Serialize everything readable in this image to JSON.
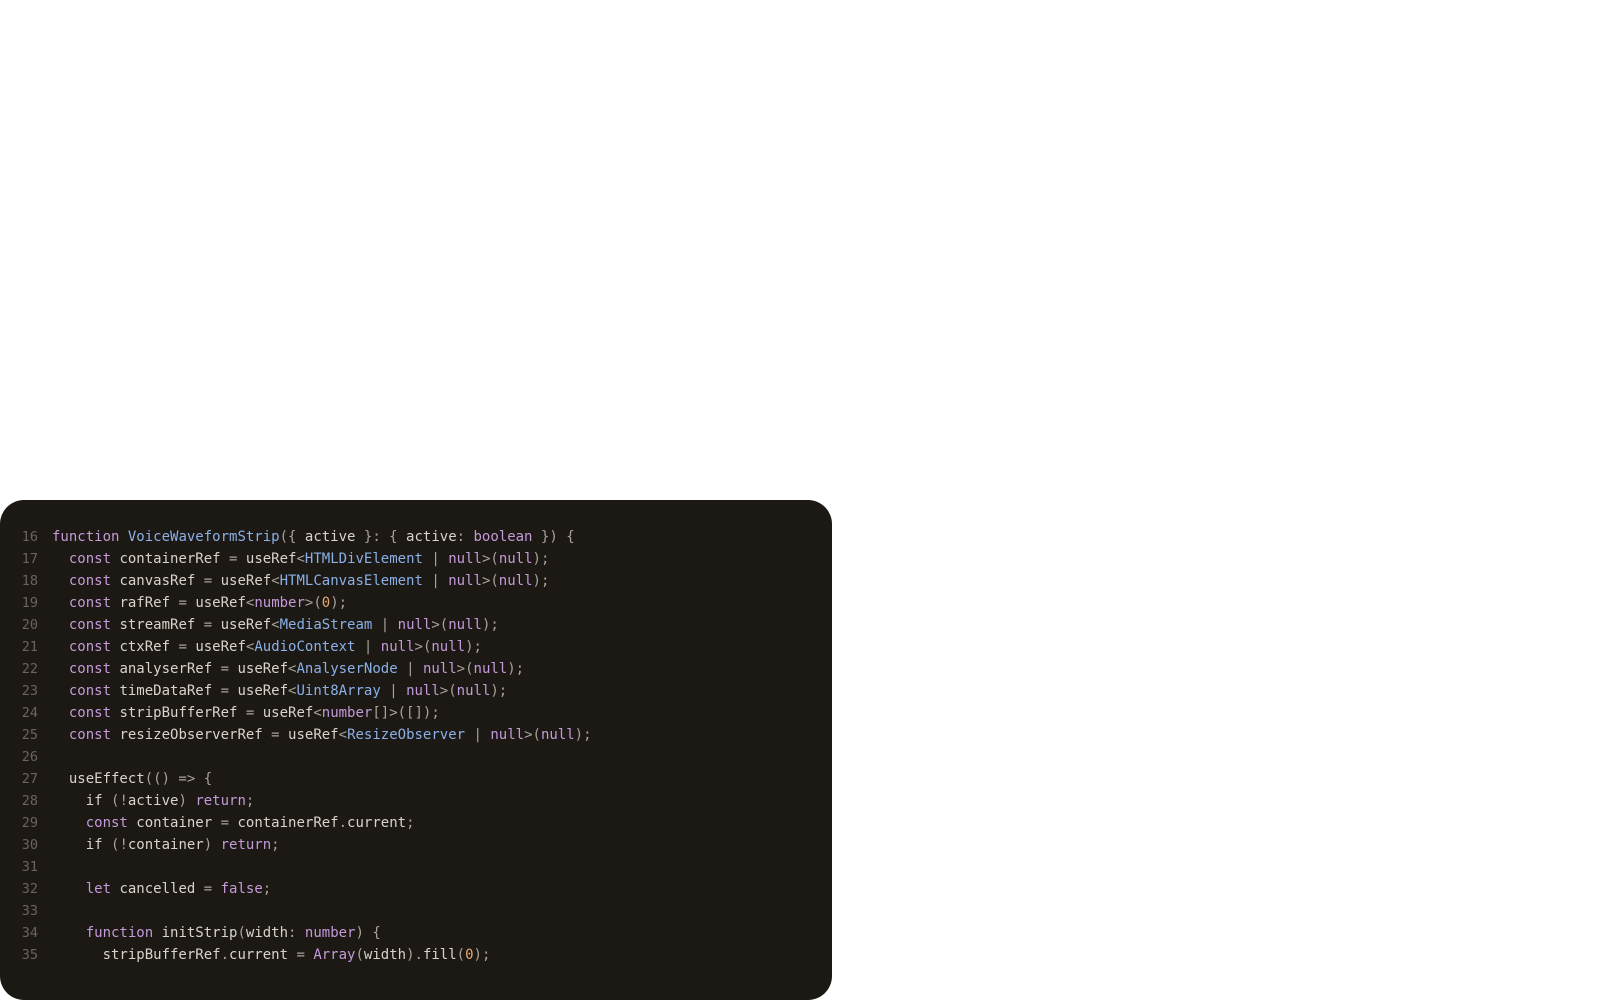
{
  "colors": {
    "background": "#1c1814",
    "keyword": "#c49ad8",
    "type": "#8ab0e6",
    "number": "#e8a86a",
    "punctuation": "#a9a29a",
    "text": "#d8d4cc",
    "line_number": "#6b645c"
  },
  "code": {
    "lines": [
      {
        "number": "16",
        "tokens": [
          {
            "t": "function",
            "k": "kw"
          },
          {
            "t": " ",
            "k": "plain"
          },
          {
            "t": "VoiceWaveformStrip",
            "k": "fn"
          },
          {
            "t": "({ ",
            "k": "punct"
          },
          {
            "t": "active",
            "k": "plain"
          },
          {
            "t": " }: { ",
            "k": "punct"
          },
          {
            "t": "active",
            "k": "plain"
          },
          {
            "t": ": ",
            "k": "punct"
          },
          {
            "t": "boolean",
            "k": "kw"
          },
          {
            "t": " }) {",
            "k": "punct"
          }
        ]
      },
      {
        "number": "17",
        "tokens": [
          {
            "t": "  ",
            "k": "plain"
          },
          {
            "t": "const",
            "k": "kw"
          },
          {
            "t": " containerRef ",
            "k": "plain"
          },
          {
            "t": "=",
            "k": "punct"
          },
          {
            "t": " useRef",
            "k": "plain"
          },
          {
            "t": "<",
            "k": "punct"
          },
          {
            "t": "HTMLDivElement",
            "k": "type"
          },
          {
            "t": " | ",
            "k": "punct"
          },
          {
            "t": "null",
            "k": "kw"
          },
          {
            "t": ">(",
            "k": "punct"
          },
          {
            "t": "null",
            "k": "kw"
          },
          {
            "t": ");",
            "k": "punct"
          }
        ]
      },
      {
        "number": "18",
        "tokens": [
          {
            "t": "  ",
            "k": "plain"
          },
          {
            "t": "const",
            "k": "kw"
          },
          {
            "t": " canvasRef ",
            "k": "plain"
          },
          {
            "t": "=",
            "k": "punct"
          },
          {
            "t": " useRef",
            "k": "plain"
          },
          {
            "t": "<",
            "k": "punct"
          },
          {
            "t": "HTMLCanvasElement",
            "k": "type"
          },
          {
            "t": " | ",
            "k": "punct"
          },
          {
            "t": "null",
            "k": "kw"
          },
          {
            "t": ">(",
            "k": "punct"
          },
          {
            "t": "null",
            "k": "kw"
          },
          {
            "t": ");",
            "k": "punct"
          }
        ]
      },
      {
        "number": "19",
        "tokens": [
          {
            "t": "  ",
            "k": "plain"
          },
          {
            "t": "const",
            "k": "kw"
          },
          {
            "t": " rafRef ",
            "k": "plain"
          },
          {
            "t": "=",
            "k": "punct"
          },
          {
            "t": " useRef",
            "k": "plain"
          },
          {
            "t": "<",
            "k": "punct"
          },
          {
            "t": "number",
            "k": "kw"
          },
          {
            "t": ">(",
            "k": "punct"
          },
          {
            "t": "0",
            "k": "num"
          },
          {
            "t": ");",
            "k": "punct"
          }
        ]
      },
      {
        "number": "20",
        "tokens": [
          {
            "t": "  ",
            "k": "plain"
          },
          {
            "t": "const",
            "k": "kw"
          },
          {
            "t": " streamRef ",
            "k": "plain"
          },
          {
            "t": "=",
            "k": "punct"
          },
          {
            "t": " useRef",
            "k": "plain"
          },
          {
            "t": "<",
            "k": "punct"
          },
          {
            "t": "MediaStream",
            "k": "type"
          },
          {
            "t": " | ",
            "k": "punct"
          },
          {
            "t": "null",
            "k": "kw"
          },
          {
            "t": ">(",
            "k": "punct"
          },
          {
            "t": "null",
            "k": "kw"
          },
          {
            "t": ");",
            "k": "punct"
          }
        ]
      },
      {
        "number": "21",
        "tokens": [
          {
            "t": "  ",
            "k": "plain"
          },
          {
            "t": "const",
            "k": "kw"
          },
          {
            "t": " ctxRef ",
            "k": "plain"
          },
          {
            "t": "=",
            "k": "punct"
          },
          {
            "t": " useRef",
            "k": "plain"
          },
          {
            "t": "<",
            "k": "punct"
          },
          {
            "t": "AudioContext",
            "k": "type"
          },
          {
            "t": " | ",
            "k": "punct"
          },
          {
            "t": "null",
            "k": "kw"
          },
          {
            "t": ">(",
            "k": "punct"
          },
          {
            "t": "null",
            "k": "kw"
          },
          {
            "t": ");",
            "k": "punct"
          }
        ]
      },
      {
        "number": "22",
        "tokens": [
          {
            "t": "  ",
            "k": "plain"
          },
          {
            "t": "const",
            "k": "kw"
          },
          {
            "t": " analyserRef ",
            "k": "plain"
          },
          {
            "t": "=",
            "k": "punct"
          },
          {
            "t": " useRef",
            "k": "plain"
          },
          {
            "t": "<",
            "k": "punct"
          },
          {
            "t": "AnalyserNode",
            "k": "type"
          },
          {
            "t": " | ",
            "k": "punct"
          },
          {
            "t": "null",
            "k": "kw"
          },
          {
            "t": ">(",
            "k": "punct"
          },
          {
            "t": "null",
            "k": "kw"
          },
          {
            "t": ");",
            "k": "punct"
          }
        ]
      },
      {
        "number": "23",
        "tokens": [
          {
            "t": "  ",
            "k": "plain"
          },
          {
            "t": "const",
            "k": "kw"
          },
          {
            "t": " timeDataRef ",
            "k": "plain"
          },
          {
            "t": "=",
            "k": "punct"
          },
          {
            "t": " useRef",
            "k": "plain"
          },
          {
            "t": "<",
            "k": "punct"
          },
          {
            "t": "Uint8Array",
            "k": "type"
          },
          {
            "t": " | ",
            "k": "punct"
          },
          {
            "t": "null",
            "k": "kw"
          },
          {
            "t": ">(",
            "k": "punct"
          },
          {
            "t": "null",
            "k": "kw"
          },
          {
            "t": ");",
            "k": "punct"
          }
        ]
      },
      {
        "number": "24",
        "tokens": [
          {
            "t": "  ",
            "k": "plain"
          },
          {
            "t": "const",
            "k": "kw"
          },
          {
            "t": " stripBufferRef ",
            "k": "plain"
          },
          {
            "t": "=",
            "k": "punct"
          },
          {
            "t": " useRef",
            "k": "plain"
          },
          {
            "t": "<",
            "k": "punct"
          },
          {
            "t": "number",
            "k": "kw"
          },
          {
            "t": "[]>([]);",
            "k": "punct"
          }
        ]
      },
      {
        "number": "25",
        "tokens": [
          {
            "t": "  ",
            "k": "plain"
          },
          {
            "t": "const",
            "k": "kw"
          },
          {
            "t": " resizeObserverRef ",
            "k": "plain"
          },
          {
            "t": "=",
            "k": "punct"
          },
          {
            "t": " useRef",
            "k": "plain"
          },
          {
            "t": "<",
            "k": "punct"
          },
          {
            "t": "ResizeObserver",
            "k": "type"
          },
          {
            "t": " | ",
            "k": "punct"
          },
          {
            "t": "null",
            "k": "kw"
          },
          {
            "t": ">(",
            "k": "punct"
          },
          {
            "t": "null",
            "k": "kw"
          },
          {
            "t": ");",
            "k": "punct"
          }
        ]
      },
      {
        "number": "26",
        "tokens": []
      },
      {
        "number": "27",
        "tokens": [
          {
            "t": "  useEffect",
            "k": "plain"
          },
          {
            "t": "(() => {",
            "k": "punct"
          }
        ]
      },
      {
        "number": "28",
        "tokens": [
          {
            "t": "    if ",
            "k": "plain"
          },
          {
            "t": "(!",
            "k": "punct"
          },
          {
            "t": "active",
            "k": "plain"
          },
          {
            "t": ") ",
            "k": "punct"
          },
          {
            "t": "return",
            "k": "kw"
          },
          {
            "t": ";",
            "k": "punct"
          }
        ]
      },
      {
        "number": "29",
        "tokens": [
          {
            "t": "    ",
            "k": "plain"
          },
          {
            "t": "const",
            "k": "kw"
          },
          {
            "t": " container ",
            "k": "plain"
          },
          {
            "t": "=",
            "k": "punct"
          },
          {
            "t": " containerRef",
            "k": "plain"
          },
          {
            "t": ".",
            "k": "punct"
          },
          {
            "t": "current",
            "k": "plain"
          },
          {
            "t": ";",
            "k": "punct"
          }
        ]
      },
      {
        "number": "30",
        "tokens": [
          {
            "t": "    if ",
            "k": "plain"
          },
          {
            "t": "(!",
            "k": "punct"
          },
          {
            "t": "container",
            "k": "plain"
          },
          {
            "t": ") ",
            "k": "punct"
          },
          {
            "t": "return",
            "k": "kw"
          },
          {
            "t": ";",
            "k": "punct"
          }
        ]
      },
      {
        "number": "31",
        "tokens": []
      },
      {
        "number": "32",
        "tokens": [
          {
            "t": "    ",
            "k": "plain"
          },
          {
            "t": "let",
            "k": "kw"
          },
          {
            "t": " cancelled ",
            "k": "plain"
          },
          {
            "t": "=",
            "k": "punct"
          },
          {
            "t": " ",
            "k": "plain"
          },
          {
            "t": "false",
            "k": "kw"
          },
          {
            "t": ";",
            "k": "punct"
          }
        ]
      },
      {
        "number": "33",
        "tokens": []
      },
      {
        "number": "34",
        "tokens": [
          {
            "t": "    ",
            "k": "plain"
          },
          {
            "t": "function",
            "k": "kw"
          },
          {
            "t": " initStrip",
            "k": "plain"
          },
          {
            "t": "(",
            "k": "punct"
          },
          {
            "t": "width",
            "k": "plain"
          },
          {
            "t": ": ",
            "k": "punct"
          },
          {
            "t": "number",
            "k": "kw"
          },
          {
            "t": ") {",
            "k": "punct"
          }
        ]
      },
      {
        "number": "35",
        "tokens": [
          {
            "t": "      stripBufferRef",
            "k": "plain"
          },
          {
            "t": ".",
            "k": "punct"
          },
          {
            "t": "current ",
            "k": "plain"
          },
          {
            "t": "=",
            "k": "punct"
          },
          {
            "t": " ",
            "k": "plain"
          },
          {
            "t": "Array",
            "k": "kw"
          },
          {
            "t": "(",
            "k": "punct"
          },
          {
            "t": "width",
            "k": "plain"
          },
          {
            "t": ").",
            "k": "punct"
          },
          {
            "t": "fill",
            "k": "plain"
          },
          {
            "t": "(",
            "k": "punct"
          },
          {
            "t": "0",
            "k": "num"
          },
          {
            "t": ");",
            "k": "punct"
          }
        ]
      }
    ]
  }
}
